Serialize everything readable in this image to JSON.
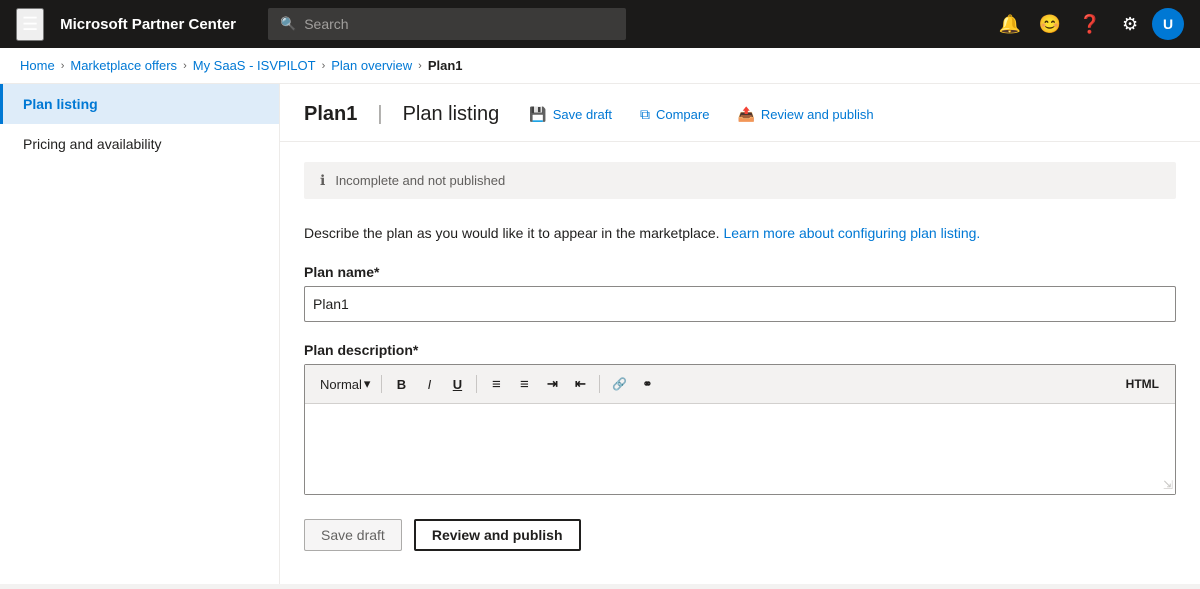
{
  "topnav": {
    "title": "Microsoft Partner Center",
    "search_placeholder": "Search",
    "hamburger_icon": "☰",
    "notification_icon": "🔔",
    "smiley_icon": "😊",
    "help_icon": "?",
    "settings_icon": "⚙",
    "avatar_label": "U"
  },
  "breadcrumb": {
    "items": [
      {
        "label": "Home",
        "link": true
      },
      {
        "label": "Marketplace offers",
        "link": true
      },
      {
        "label": "My SaaS - ISVPILOT",
        "link": true
      },
      {
        "label": "Plan overview",
        "link": true
      },
      {
        "label": "Plan1",
        "link": false
      }
    ],
    "separator": "›"
  },
  "sidebar": {
    "items": [
      {
        "label": "Plan listing",
        "active": true
      },
      {
        "label": "Pricing and availability",
        "active": false
      }
    ]
  },
  "main": {
    "plan_name": "Plan1",
    "page_subtitle": "Plan listing",
    "separator": "|",
    "header_actions": {
      "save_draft": "Save draft",
      "compare": "Compare",
      "review_publish": "Review and publish"
    },
    "info_banner": {
      "text": "Incomplete and not published"
    },
    "description": "Describe the plan as you would like it to appear in the marketplace.",
    "description_link": "Learn more about configuring plan listing.",
    "form": {
      "plan_name_label": "Plan name*",
      "plan_name_value": "Plan1",
      "plan_description_label": "Plan description*"
    },
    "rte_toolbar": {
      "format_label": "Normal",
      "format_arrow": "▾",
      "bold": "B",
      "italic": "I",
      "underline": "U",
      "ol": "≡",
      "ul": "≡",
      "indent": "⇥",
      "outdent": "⇤",
      "link": "🔗",
      "unlink": "⚭",
      "html_label": "HTML"
    },
    "bottom_actions": {
      "save_draft": "Save draft",
      "review_publish": "Review and publish"
    }
  }
}
